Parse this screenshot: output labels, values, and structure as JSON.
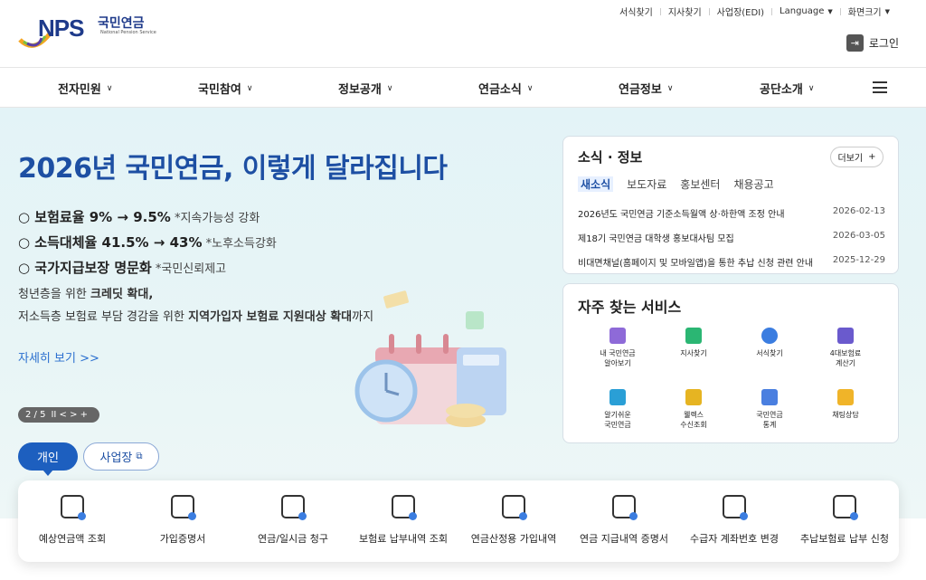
{
  "header": {
    "logo_main": "NPS",
    "logo_kr": "국민연금",
    "logo_en": "National Pension Service",
    "util_links": [
      "서식찾기",
      "지사찾기",
      "사업장(EDI)",
      "Language",
      "화면크기"
    ],
    "login_label": "로그인"
  },
  "nav": {
    "items": [
      "전자민원",
      "국민참여",
      "정보공개",
      "연금소식",
      "연금정보",
      "공단소개"
    ]
  },
  "hero": {
    "title": "2026년 국민연금, 이렇게 달라집니다",
    "bullets": [
      {
        "main": "○ 보험료율 9% → 9.5%",
        "note": " *지속가능성 강화"
      },
      {
        "main": "○ 소득대체율 41.5% → 43%",
        "note": " *노후소득강화"
      },
      {
        "main": "○ 국가지급보장 명문화",
        "note": " *국민신뢰제고"
      }
    ],
    "desc1_prefix": "청년층을 위한 ",
    "desc1_bold": "크레딧 확대,",
    "desc2_prefix": "저소득층 보험료 부담 경감을 위한 ",
    "desc2_bold": "지역가입자 보험료 지원대상 확대",
    "desc2_suffix": "까지",
    "more_link": "자세히 보기 >>",
    "slider_counter": "2 / 5",
    "slider_controls": "II  <  >  +",
    "tab_personal": "개인",
    "tab_business": "사업장"
  },
  "news": {
    "title": "소식 · 정보",
    "more": "더보기",
    "tabs": [
      "새소식",
      "보도자료",
      "홍보센터",
      "채용공고"
    ],
    "rows": [
      {
        "title": "2026년도 국민연금 기준소득월액 상·하한액 조정 안내",
        "date": "2026-02-13"
      },
      {
        "title": "제18기 국민연금 대학생 홍보대사팀 모집",
        "date": "2026-03-05"
      },
      {
        "title": "비대면채널(홈페이지 및 모바일앱)을 통한 추납 신청 관련 안내",
        "date": "2025-12-29"
      }
    ]
  },
  "services": {
    "title": "자주 찾는 서비스",
    "items": [
      {
        "l1": "내 국민연금",
        "l2": "알아보기",
        "color": "#8e6ad8"
      },
      {
        "l1": "지사찾기",
        "l2": "",
        "color": "#2bb673"
      },
      {
        "l1": "서식찾기",
        "l2": "",
        "color": "#3b7de0"
      },
      {
        "l1": "4대보험료",
        "l2": "계산기",
        "color": "#6a5acd"
      },
      {
        "l1": "알기쉬운",
        "l2": "국민연금",
        "color": "#2a9fd6"
      },
      {
        "l1": "웰렉스",
        "l2": "수신조회",
        "color": "#e6b422"
      },
      {
        "l1": "국민연금",
        "l2": "통계",
        "color": "#4a7fe0"
      },
      {
        "l1": "채팅상담",
        "l2": "",
        "color": "#f0b429"
      }
    ]
  },
  "quick": {
    "items": [
      "예상연금액 조회",
      "가입증명서",
      "연금/일시금 청구",
      "보험료 납부내역 조회",
      "연금산정용 가입내역",
      "연금 지급내역 증명서",
      "수급자 계좌번호 변경",
      "추납보험료 납부 신청"
    ]
  }
}
